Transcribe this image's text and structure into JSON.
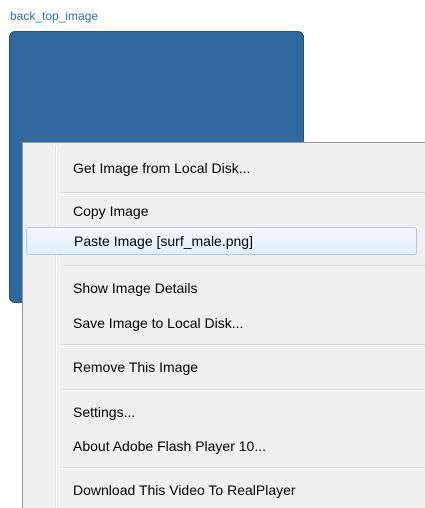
{
  "image_field": {
    "title": "back_top_image"
  },
  "context_menu": {
    "items": [
      {
        "label": "Get Image from Local Disk..."
      },
      {
        "label": "Copy Image"
      },
      {
        "label": "Paste Image [surf_male.png]"
      },
      {
        "label": "Show Image Details"
      },
      {
        "label": "Save Image to Local Disk..."
      },
      {
        "label": "Remove This Image"
      },
      {
        "label": "Settings..."
      },
      {
        "label": "About Adobe Flash Player 10..."
      },
      {
        "label": "Download This Video To RealPlayer"
      }
    ]
  },
  "colors": {
    "image_fill": "#2e6a9e",
    "title_text": "#2f6fae",
    "highlight_border": "#a8cbf0"
  }
}
